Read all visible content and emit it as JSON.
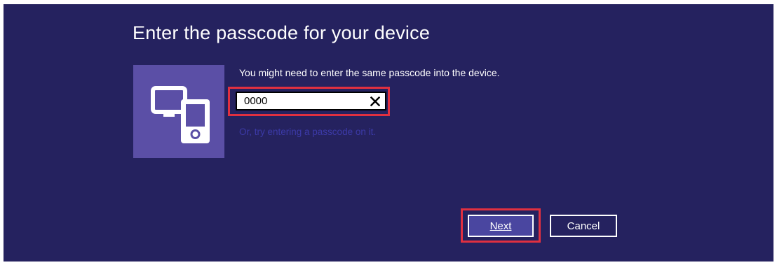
{
  "dialog": {
    "title": "Enter the passcode for your device",
    "instruction": "You might need to enter the same passcode into the device.",
    "passcode": {
      "value": "0000",
      "clear_icon": "close-icon"
    },
    "alt_link": "Or, try entering a passcode on it.",
    "device_icon": "devices-icon",
    "buttons": {
      "next": "Next",
      "cancel": "Cancel"
    }
  },
  "colors": {
    "background": "#25225f",
    "tile": "#5b4fa6",
    "link": "#3c3aa8",
    "highlight": "#e03040",
    "next_button": "#4a46a0"
  }
}
